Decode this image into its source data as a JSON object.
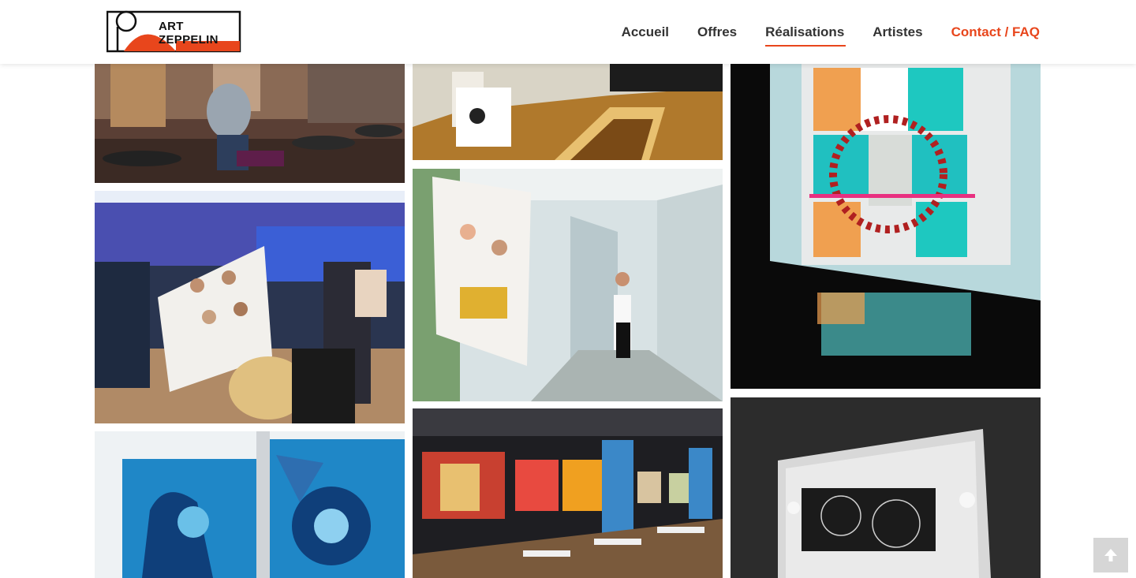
{
  "brand": {
    "logo_text": "ART ZEPPELIN",
    "accent_color": "#e8461c"
  },
  "nav": {
    "items": [
      {
        "label": "Accueil",
        "state": "normal"
      },
      {
        "label": "Offres",
        "state": "normal"
      },
      {
        "label": "Réalisations",
        "state": "active"
      },
      {
        "label": "Artistes",
        "state": "normal"
      },
      {
        "label": "Contact / FAQ",
        "state": "accent"
      }
    ]
  },
  "gallery": {
    "columns": [
      {
        "tiles": [
          {
            "depicts": "restaurant-mural-photo"
          },
          {
            "depicts": "live-painting-event-photo"
          },
          {
            "depicts": "blue-fresco-wall-photo"
          }
        ]
      },
      {
        "tiles": [
          {
            "depicts": "staircase-exhibition-photo"
          },
          {
            "depicts": "corridor-gallery-photo"
          },
          {
            "depicts": "restaurant-paintings-photo"
          }
        ]
      },
      {
        "tiles": [
          {
            "depicts": "lightbox-artwork-photo"
          },
          {
            "depicts": "lightbox-dark-artwork-photo"
          }
        ]
      }
    ]
  },
  "back_to_top": {
    "icon": "arrow-up-icon"
  }
}
